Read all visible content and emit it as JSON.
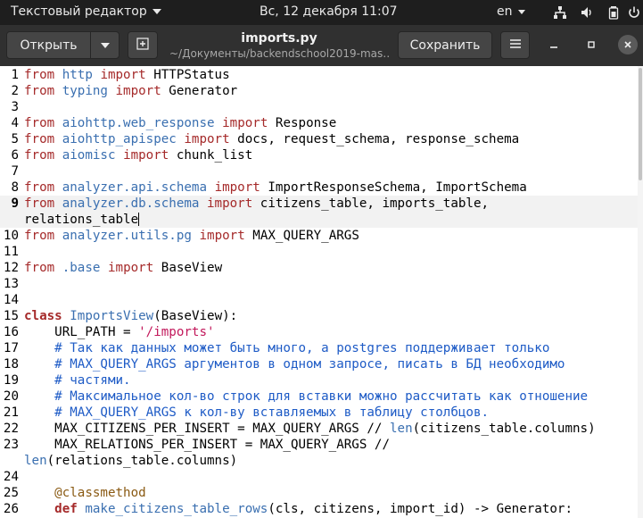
{
  "system_bar": {
    "app_menu_label": "Текстовый редактор",
    "clock": "Вс, 12 декабря  11:07",
    "language": "en",
    "tray_icons": [
      "network-icon",
      "volume-icon",
      "battery-icon",
      "power-icon"
    ]
  },
  "header": {
    "open_label": "Открыть",
    "file_name": "imports.py",
    "file_path": "~/Документы/backendschool2019-mas…",
    "save_label": "Сохранить"
  },
  "editor": {
    "current_line": "9",
    "lines": [
      {
        "num": "1",
        "tokens": [
          [
            "kw",
            "from"
          ],
          [
            "t",
            " "
          ],
          [
            "mod",
            "http"
          ],
          [
            "t",
            " "
          ],
          [
            "kw",
            "import"
          ],
          [
            "t",
            " HTTPStatus"
          ]
        ]
      },
      {
        "num": "2",
        "tokens": [
          [
            "kw",
            "from"
          ],
          [
            "t",
            " "
          ],
          [
            "mod",
            "typing"
          ],
          [
            "t",
            " "
          ],
          [
            "kw",
            "import"
          ],
          [
            "t",
            " Generator"
          ]
        ]
      },
      {
        "num": "3",
        "tokens": []
      },
      {
        "num": "4",
        "tokens": [
          [
            "kw",
            "from"
          ],
          [
            "t",
            " "
          ],
          [
            "mod",
            "aiohttp.web_response"
          ],
          [
            "t",
            " "
          ],
          [
            "kw",
            "import"
          ],
          [
            "t",
            " Response"
          ]
        ]
      },
      {
        "num": "5",
        "tokens": [
          [
            "kw",
            "from"
          ],
          [
            "t",
            " "
          ],
          [
            "mod",
            "aiohttp_apispec"
          ],
          [
            "t",
            " "
          ],
          [
            "kw",
            "import"
          ],
          [
            "t",
            " docs, request_schema, response_schema"
          ]
        ]
      },
      {
        "num": "6",
        "tokens": [
          [
            "kw",
            "from"
          ],
          [
            "t",
            " "
          ],
          [
            "mod",
            "aiomisc"
          ],
          [
            "t",
            " "
          ],
          [
            "kw",
            "import"
          ],
          [
            "t",
            " chunk_list"
          ]
        ]
      },
      {
        "num": "7",
        "tokens": []
      },
      {
        "num": "8",
        "tokens": [
          [
            "kw",
            "from"
          ],
          [
            "t",
            " "
          ],
          [
            "mod",
            "analyzer.api.schema"
          ],
          [
            "t",
            " "
          ],
          [
            "kw",
            "import"
          ],
          [
            "t",
            " ImportResponseSchema, ImportSchema"
          ]
        ]
      },
      {
        "num": "9",
        "tokens": [
          [
            "kw",
            "from"
          ],
          [
            "t",
            " "
          ],
          [
            "mod",
            "analyzer.db.schema"
          ],
          [
            "t",
            " "
          ],
          [
            "kw",
            "import"
          ],
          [
            "t",
            " citizens_table, imports_table,"
          ]
        ],
        "current": true
      },
      {
        "num": "",
        "tokens": [
          [
            "t",
            "relations_table"
          ]
        ],
        "current": true,
        "cursor": true
      },
      {
        "num": "10",
        "tokens": [
          [
            "kw",
            "from"
          ],
          [
            "t",
            " "
          ],
          [
            "mod",
            "analyzer.utils.pg"
          ],
          [
            "t",
            " "
          ],
          [
            "kw",
            "import"
          ],
          [
            "t",
            " MAX_QUERY_ARGS"
          ]
        ]
      },
      {
        "num": "11",
        "tokens": []
      },
      {
        "num": "12",
        "tokens": [
          [
            "kw",
            "from"
          ],
          [
            "t",
            " "
          ],
          [
            "mod",
            ".base"
          ],
          [
            "t",
            " "
          ],
          [
            "kw",
            "import"
          ],
          [
            "t",
            " BaseView"
          ]
        ]
      },
      {
        "num": "13",
        "tokens": []
      },
      {
        "num": "14",
        "tokens": []
      },
      {
        "num": "15",
        "tokens": [
          [
            "kwb",
            "class"
          ],
          [
            "t",
            " "
          ],
          [
            "fn",
            "ImportsView"
          ],
          [
            "t",
            "(BaseView):"
          ]
        ]
      },
      {
        "num": "16",
        "tokens": [
          [
            "t",
            "    URL_PATH = "
          ],
          [
            "str",
            "'/imports'"
          ]
        ]
      },
      {
        "num": "17",
        "tokens": [
          [
            "t",
            "    "
          ],
          [
            "com",
            "# Так как данных может быть много, а postgres поддерживает только"
          ]
        ]
      },
      {
        "num": "18",
        "tokens": [
          [
            "t",
            "    "
          ],
          [
            "com",
            "# MAX_QUERY_ARGS аргументов в одном запросе, писать в БД необходимо"
          ]
        ]
      },
      {
        "num": "19",
        "tokens": [
          [
            "t",
            "    "
          ],
          [
            "com",
            "# частями."
          ]
        ]
      },
      {
        "num": "20",
        "tokens": [
          [
            "t",
            "    "
          ],
          [
            "com",
            "# Максимальное кол-во строк для вставки можно рассчитать как отношение"
          ]
        ]
      },
      {
        "num": "21",
        "tokens": [
          [
            "t",
            "    "
          ],
          [
            "com",
            "# MAX_QUERY_ARGS к кол-ву вставляемых в таблицу столбцов."
          ]
        ]
      },
      {
        "num": "22",
        "tokens": [
          [
            "t",
            "    MAX_CITIZENS_PER_INSERT = MAX_QUERY_ARGS // "
          ],
          [
            "fn",
            "len"
          ],
          [
            "t",
            "(citizens_table.columns)"
          ]
        ]
      },
      {
        "num": "23",
        "tokens": [
          [
            "t",
            "    MAX_RELATIONS_PER_INSERT = MAX_QUERY_ARGS //"
          ]
        ]
      },
      {
        "num": "",
        "tokens": [
          [
            "fn",
            "len"
          ],
          [
            "t",
            "(relations_table.columns)"
          ]
        ]
      },
      {
        "num": "24",
        "tokens": []
      },
      {
        "num": "25",
        "tokens": [
          [
            "t",
            "    "
          ],
          [
            "deco",
            "@classmethod"
          ]
        ]
      },
      {
        "num": "26",
        "tokens": [
          [
            "t",
            "    "
          ],
          [
            "kwb",
            "def"
          ],
          [
            "t",
            " "
          ],
          [
            "fn",
            "make_citizens_table_rows"
          ],
          [
            "t",
            "(cls, citizens, import_id) -> Generator:"
          ]
        ]
      }
    ]
  }
}
